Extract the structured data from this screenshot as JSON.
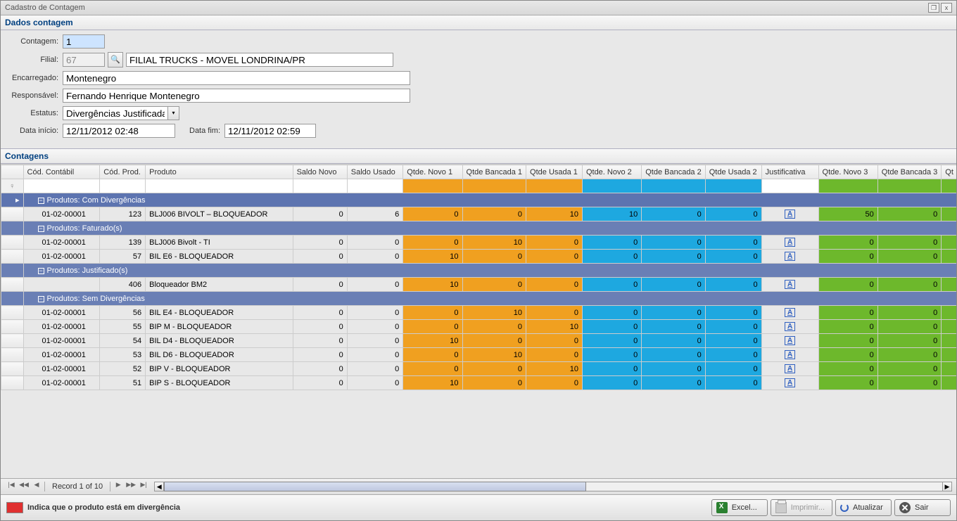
{
  "window": {
    "title": "Cadastro de Contagem"
  },
  "section_dados": "Dados contagem",
  "section_contagens": "Contagens",
  "form": {
    "labels": {
      "contagem": "Contagem:",
      "filial": "Filial:",
      "encarregado": "Encarregado:",
      "responsavel": "Responsável:",
      "estatus": "Estatus:",
      "data_inicio": "Data início:",
      "data_fim": "Data fim:"
    },
    "values": {
      "contagem": "1",
      "filial_code": "67",
      "filial_name": "FILIAL TRUCKS - MOVEL LONDRINA/PR",
      "encarregado": "Montenegro",
      "responsavel": "Fernando Henrique Montenegro",
      "estatus": "Divergências Justificadas",
      "data_inicio": "12/11/2012 02:48",
      "data_fim": "12/11/2012 02:59"
    }
  },
  "grid": {
    "columns": [
      "Cód. Contábil",
      "Cód. Prod.",
      "Produto",
      "Saldo Novo",
      "Saldo Usado",
      "Qtde. Novo 1",
      "Qtde Bancada 1",
      "Qtde Usada 1",
      "Qtde. Novo 2",
      "Qtde Bancada 2",
      "Qtde Usada 2",
      "Justificativa",
      "Qtde. Novo 3",
      "Qtde Bancada 3",
      "Qt"
    ],
    "groups": [
      {
        "label": "Produtos: Com Divergências",
        "selected": true,
        "rows": [
          {
            "cod_contabil": "01-02-00001",
            "cod_prod": "123",
            "produto": "BLJ006 BIVOLT – BLOQUEADOR",
            "saldo_novo": "0",
            "saldo_usado": "6",
            "n1": "0",
            "b1": "0",
            "u1": "10",
            "n2": "10",
            "b2": "0",
            "u2": "0",
            "j": "A",
            "n3": "50",
            "b3": "0"
          }
        ]
      },
      {
        "label": "Produtos: Faturado(s)",
        "rows": [
          {
            "cod_contabil": "01-02-00001",
            "cod_prod": "139",
            "produto": "BLJ006 Bivolt - TI",
            "saldo_novo": "0",
            "saldo_usado": "0",
            "n1": "0",
            "b1": "10",
            "u1": "0",
            "n2": "0",
            "b2": "0",
            "u2": "0",
            "j": "A",
            "n3": "0",
            "b3": "0"
          },
          {
            "cod_contabil": "01-02-00001",
            "cod_prod": "57",
            "produto": "BIL E6 - BLOQUEADOR",
            "saldo_novo": "0",
            "saldo_usado": "0",
            "n1": "10",
            "b1": "0",
            "u1": "0",
            "n2": "0",
            "b2": "0",
            "u2": "0",
            "j": "A",
            "n3": "0",
            "b3": "0"
          }
        ]
      },
      {
        "label": "Produtos: Justificado(s)",
        "rows": [
          {
            "cod_contabil": "",
            "cod_prod": "406",
            "produto": "Bloqueador  BM2",
            "saldo_novo": "0",
            "saldo_usado": "0",
            "n1": "10",
            "b1": "0",
            "u1": "0",
            "n2": "0",
            "b2": "0",
            "u2": "0",
            "j": "A",
            "n3": "0",
            "b3": "0"
          }
        ]
      },
      {
        "label": "Produtos: Sem Divergências",
        "rows": [
          {
            "cod_contabil": "01-02-00001",
            "cod_prod": "56",
            "produto": "BIL E4 - BLOQUEADOR",
            "saldo_novo": "0",
            "saldo_usado": "0",
            "n1": "0",
            "b1": "10",
            "u1": "0",
            "n2": "0",
            "b2": "0",
            "u2": "0",
            "j": "A",
            "n3": "0",
            "b3": "0"
          },
          {
            "cod_contabil": "01-02-00001",
            "cod_prod": "55",
            "produto": "BIP M - BLOQUEADOR",
            "saldo_novo": "0",
            "saldo_usado": "0",
            "n1": "0",
            "b1": "0",
            "u1": "10",
            "n2": "0",
            "b2": "0",
            "u2": "0",
            "j": "A",
            "n3": "0",
            "b3": "0"
          },
          {
            "cod_contabil": "01-02-00001",
            "cod_prod": "54",
            "produto": "BIL D4 - BLOQUEADOR",
            "saldo_novo": "0",
            "saldo_usado": "0",
            "n1": "10",
            "b1": "0",
            "u1": "0",
            "n2": "0",
            "b2": "0",
            "u2": "0",
            "j": "A",
            "n3": "0",
            "b3": "0"
          },
          {
            "cod_contabil": "01-02-00001",
            "cod_prod": "53",
            "produto": "BIL D6 - BLOQUEADOR",
            "saldo_novo": "0",
            "saldo_usado": "0",
            "n1": "0",
            "b1": "10",
            "u1": "0",
            "n2": "0",
            "b2": "0",
            "u2": "0",
            "j": "A",
            "n3": "0",
            "b3": "0"
          },
          {
            "cod_contabil": "01-02-00001",
            "cod_prod": "52",
            "produto": "BIP V - BLOQUEADOR",
            "saldo_novo": "0",
            "saldo_usado": "0",
            "n1": "0",
            "b1": "0",
            "u1": "10",
            "n2": "0",
            "b2": "0",
            "u2": "0",
            "j": "A",
            "n3": "0",
            "b3": "0"
          },
          {
            "cod_contabil": "01-02-00001",
            "cod_prod": "51",
            "produto": "BIP S - BLOQUEADOR",
            "saldo_novo": "0",
            "saldo_usado": "0",
            "n1": "10",
            "b1": "0",
            "u1": "0",
            "n2": "0",
            "b2": "0",
            "u2": "0",
            "j": "A",
            "n3": "0",
            "b3": "0"
          }
        ]
      }
    ]
  },
  "nav": {
    "record_text": "Record 1 of 10"
  },
  "legend": "Indica que o produto está em divergência",
  "buttons": {
    "excel": "Excel...",
    "imprimir": "Imprimir...",
    "atualizar": "Atualizar",
    "sair": "Sair"
  }
}
